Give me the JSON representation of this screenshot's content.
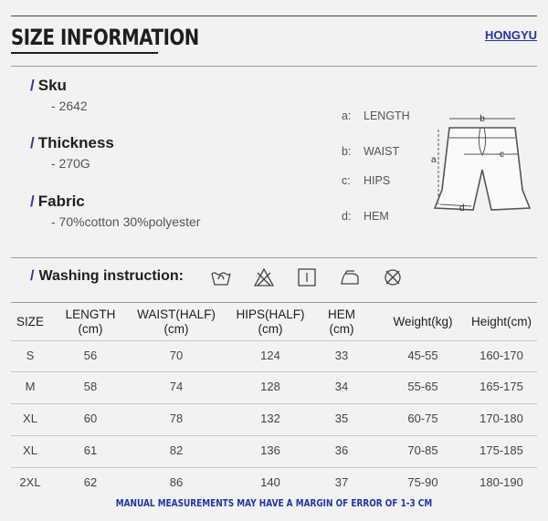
{
  "header": {
    "title": "SIZE INFORMATION",
    "brand": "HONGYU"
  },
  "specs": [
    {
      "slash": "/",
      "label": "Sku",
      "value": "- 2642"
    },
    {
      "slash": "/",
      "label": "Thickness",
      "value": "- 270G"
    },
    {
      "slash": "/",
      "label": "Fabric",
      "value": "- 70%cotton  30%polyester"
    }
  ],
  "legend": [
    {
      "key": "a:",
      "text": "LENGTH"
    },
    {
      "key": "b:",
      "text": "WAIST"
    },
    {
      "key": "c:",
      "text": "HIPS"
    },
    {
      "key": "d:",
      "text": "HEM"
    }
  ],
  "diagram_labels": {
    "a": "a",
    "b": "b",
    "c": "c",
    "d": "d"
  },
  "washing": {
    "slash": "/",
    "label": "Washing instruction:",
    "icons": [
      "hand-wash-icon",
      "no-bleach-icon",
      "tumble-dry-icon",
      "iron-icon",
      "no-dry-clean-icon"
    ]
  },
  "table": {
    "headers": [
      {
        "l1": "SIZE",
        "l2": ""
      },
      {
        "l1": "LENGTH",
        "l2": "(cm)"
      },
      {
        "l1": "WAIST(HALF)",
        "l2": "(cm)"
      },
      {
        "l1": "HIPS(HALF)",
        "l2": "(cm)"
      },
      {
        "l1": "HEM",
        "l2": "(cm)"
      },
      {
        "l1": "Weight(kg)",
        "l2": ""
      },
      {
        "l1": "Height(cm)",
        "l2": ""
      }
    ],
    "rows": [
      [
        "S",
        "56",
        "70",
        "124",
        "33",
        "45-55",
        "160-170"
      ],
      [
        "M",
        "58",
        "74",
        "128",
        "34",
        "55-65",
        "165-175"
      ],
      [
        "XL",
        "60",
        "78",
        "132",
        "35",
        "60-75",
        "170-180"
      ],
      [
        "XL",
        "61",
        "82",
        "136",
        "36",
        "70-85",
        "175-185"
      ],
      [
        "2XL",
        "62",
        "86",
        "140",
        "37",
        "75-90",
        "180-190"
      ]
    ]
  },
  "footer": "MANUAL MEASUREMENTS MAY HAVE A MARGIN OF ERROR OF 1-3 CM",
  "colors": {
    "accent": "#2b3a9c",
    "brand": "#2334a8",
    "background": "#f2f2f2"
  }
}
